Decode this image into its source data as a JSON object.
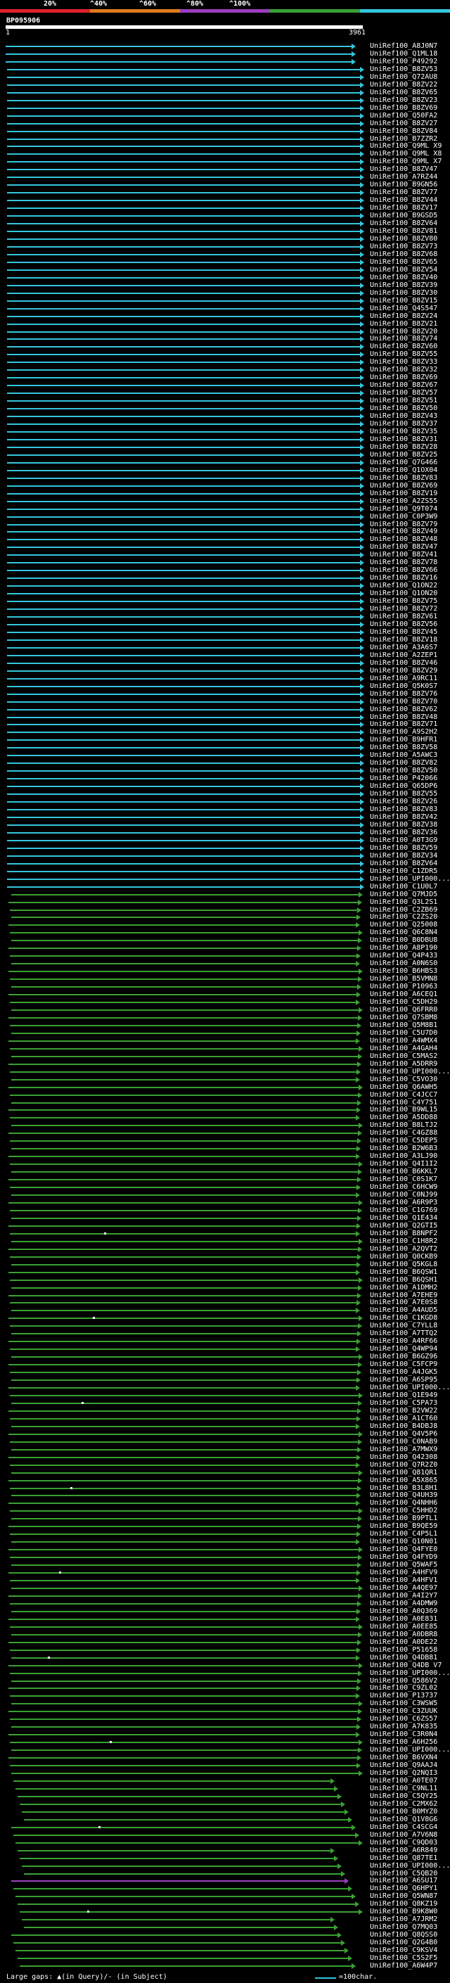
{
  "legend": {
    "labels": [
      "20%",
      "^40%",
      "^60%",
      "^80%",
      "^100%"
    ],
    "colors": [
      "#e0232d",
      "#e07b1f",
      "#9b3fbf",
      "#3aa033",
      "#35c5dd"
    ]
  },
  "title": "BP095906",
  "query": {
    "start": "1",
    "end": "3961"
  },
  "colors": {
    "cyan": "#35c5dd",
    "green": "#3aa033",
    "magenta": "#9b3fbf"
  },
  "hits": [
    "UniRef100_A8J0N7",
    "UniRef100_Q1ML18",
    "UniRef100_P49292",
    "UniRef100_B8ZV53",
    "UniRef100_Q72AU8",
    "UniRef100_B8ZV22",
    "UniRef100_B8ZV65",
    "UniRef100_B8ZV23",
    "UniRef100_B8ZV69",
    "UniRef100_Q50FA2",
    "UniRef100_B8ZV27",
    "UniRef100_B8ZV84",
    "UniRef100_B7ZZR2",
    "UniRef100_Q9ML X9",
    "UniRef100_Q9ML X8",
    "UniRef100_Q9ML X7",
    "UniRef100_B8ZV47",
    "UniRef100_A7RZ44",
    "UniRef100_B9GN56",
    "UniRef100_B8ZV77",
    "UniRef100_B8ZV44",
    "UniRef100_B8ZV17",
    "UniRef100_B9GSD5",
    "UniRef100_B8ZV64",
    "UniRef100_B8ZV81",
    "UniRef100_B8ZV80",
    "UniRef100_B8ZV73",
    "UniRef100_B8ZV68",
    "UniRef100_B8ZV65",
    "UniRef100_B8ZV54",
    "UniRef100_B8ZV40",
    "UniRef100_B8ZV39",
    "UniRef100_B8ZV30",
    "UniRef100_B8ZV15",
    "UniRef100_Q4S547",
    "UniRef100_B8ZV24",
    "UniRef100_B8ZV21",
    "UniRef100_B8ZV20",
    "UniRef100_B8ZV74",
    "UniRef100_B8ZV60",
    "UniRef100_B8ZV55",
    "UniRef100_B8ZV33",
    "UniRef100_B8ZV32",
    "UniRef100_B8ZV69",
    "UniRef100_B8ZV67",
    "UniRef100_B8ZV57",
    "UniRef100_B8ZV51",
    "UniRef100_B8ZV50",
    "UniRef100_B8ZV43",
    "UniRef100_B8ZV37",
    "UniRef100_B8ZV35",
    "UniRef100_B8ZV31",
    "UniRef100_B8ZV28",
    "UniRef100_B8ZV25",
    "UniRef100_Q7G466",
    "UniRef100_Q1OX04",
    "UniRef100_B8ZV83",
    "UniRef100_B8ZV69",
    "UniRef100_B8ZV19",
    "UniRef100_A2ZS55",
    "UniRef100_Q9T074",
    "UniRef100_C0P3W9",
    "UniRef100_B8ZV79",
    "UniRef100_B8ZV49",
    "UniRef100_B8ZV48",
    "UniRef100_B8ZV47",
    "UniRef100_B8ZV41",
    "UniRef100_B8ZV78",
    "UniRef100_B8ZV66",
    "UniRef100_B8ZV16",
    "UniRef100_Q1ON22",
    "UniRef100_Q1ON20",
    "UniRef100_B8ZV75",
    "UniRef100_B8ZV72",
    "UniRef100_B8ZV61",
    "UniRef100_B8ZV56",
    "UniRef100_B8ZV45",
    "UniRef100_B8ZV18",
    "UniRef100_A3A6S7",
    "UniRef100_A2ZEP1",
    "UniRef100_B8ZV46",
    "UniRef100_B8ZV29",
    "UniRef100_A9RC11",
    "UniRef100_Q5K0S7",
    "UniRef100_B8ZV76",
    "UniRef100_B8ZV70",
    "UniRef100_B8ZV62",
    "UniRef100_B8ZV48",
    "UniRef100_B8ZV71",
    "UniRef100_A9S2H2",
    "UniRef100_B9HFR1",
    "UniRef100_B8ZV58",
    "UniRef100_A5AWC3",
    "UniRef100_B8ZV82",
    "UniRef100_B8ZV50",
    "UniRef100_P42066",
    "UniRef100_Q65DP6",
    "UniRef100_B8ZV55",
    "UniRef100_B8ZV26",
    "UniRef100_B8ZV83",
    "UniRef100_B8ZV42",
    "UniRef100_B8ZV38",
    "UniRef100_B8ZV36",
    "UniRef100_A0T3G9",
    "UniRef100_B8ZV59",
    "UniRef100_B8ZV34",
    "UniRef100_B8ZV64",
    "UniRef100_C1ZDR5",
    "UniRef100_UPI000...",
    "UniRef100_C1U0L7",
    "UniRef100_Q7MJD5",
    "UniRef100_Q3L2S1",
    "UniRef100_C2ZB69",
    "UniRef100_C2ZS20",
    "UniRef100_Q25008",
    "UniRef100_Q6C8N4",
    "UniRef100_B0DBU8",
    "UniRef100_A8P190",
    "UniRef100_Q4P433",
    "UniRef100_A0N6S0",
    "UniRef100_B6HBS3",
    "UniRef100_B5VMN8",
    "UniRef100_P10963",
    "UniRef100_A6CEQ1",
    "UniRef100_C5DH29",
    "UniRef100_Q6FRR0",
    "UniRef100_Q7SBM8",
    "UniRef100_Q5M8B1",
    "UniRef100_C5U7D0",
    "UniRef100_A4WMX4",
    "UniRef100_A4GAH4",
    "UniRef100_C5MAS2",
    "UniRef100_A5DRR9",
    "UniRef100_UPI000...",
    "UniRef100_C5VO30",
    "UniRef100_Q6AWH5",
    "UniRef100_C4JCC7",
    "UniRef100_C4Y751",
    "UniRef100_B9WL15",
    "UniRef100_A5DD88",
    "UniRef100_B8LTJ2",
    "UniRef100_C4GZ88",
    "UniRef100_C5DEP5",
    "UniRef100_B2W6B3",
    "UniRef100_A3LJ90",
    "UniRef100_Q4I1I2",
    "UniRef100_B6KKL7",
    "UniRef100_C0S1K7",
    "UniRef100_C6HCW9",
    "UniRef100_C0NJ99",
    "UniRef100_A6R9P3",
    "UniRef100_C1G769",
    "UniRef100_Q1E434",
    "UniRef100_Q2GTI5",
    "UniRef100_B8NPF2",
    "UniRef100_C1H8R2",
    "UniRef100_A2QVT2",
    "UniRef100_Q0CKB9",
    "UniRef100_Q5KGL8",
    "UniRef100_B6QSW1",
    "UniRef100_B6QSH1",
    "UniRef100_A1DMH2",
    "UniRef100_A7EHE9",
    "UniRef100_A7E0S8",
    "UniRef100_A4AUD5",
    "UniRef100_C1KGD8",
    "UniRef100_C7YLL8",
    "UniRef100_A7TTQ2",
    "UniRef100_A4RF66",
    "UniRef100_Q4WP94",
    "UniRef100_B6GZ96",
    "UniRef100_C5FCP9",
    "UniRef100_A4JGK5",
    "UniRef100_A6SP95",
    "UniRef100_UPI000...",
    "UniRef100_Q1E949",
    "UniRef100_C5PA73",
    "UniRef100_B2VW22",
    "UniRef100_A1CT60",
    "UniRef100_B4DBJ8",
    "UniRef100_Q4V5P6",
    "UniRef100_C0NAB9",
    "UniRef100_A7MWX9",
    "UniRef100_Q42308",
    "UniRef100_Q7R2Z0",
    "UniRef100_Q81QR1",
    "UniRef100_A5X865",
    "UniRef100_B3L8H1",
    "UniRef100_Q4UH39",
    "UniRef100_Q4NHH6",
    "UniRef100_C5HHD2",
    "UniRef100_B9PTL1",
    "UniRef100_B9QE59",
    "UniRef100_C4P5L1",
    "UniRef100_Q10N01",
    "UniRef100_Q4FYE0",
    "UniRef100_Q4FYD9",
    "UniRef100_Q5WAF5",
    "UniRef100_A4HFV9",
    "UniRef100_A4HFV1",
    "UniRef100_A4QE97",
    "UniRef100_A4I2Y7",
    "UniRef100_A4DMW9",
    "UniRef100_A0Q369",
    "UniRef100_A0E831",
    "UniRef100_A0EE85",
    "UniRef100_A0DBR8",
    "UniRef100_A0DE22",
    "UniRef100_P51658",
    "UniRef100_Q4DB81",
    "UniRef100_Q4DB V7",
    "UniRef100_UPI000...",
    "UniRef100_Q586V2",
    "UniRef100_C9ZL02",
    "UniRef100_P13737",
    "UniRef100_C3WSW5",
    "UniRef100_C3ZUUK",
    "UniRef100_C6ZS57",
    "UniRef100_A7K835",
    "UniRef100_C3R0N4",
    "UniRef100_A6H256",
    "UniRef100_UPI000...",
    "UniRef100_B6VXN4",
    "UniRef100_Q9AAJ4",
    "UniRef100_Q2NQI3",
    "UniRef100_A0TE07",
    "UniRef100_C9NL11",
    "UniRef100_C5QY25",
    "UniRef100_C2MX62",
    "UniRef100_B0MYZ0",
    "UniRef100_Q1V8G6",
    "UniRef100_C4SCG4",
    "UniRef100_A7V6N8",
    "UniRef100_C9QD03",
    "UniRef100_A6R849",
    "UniRef100_Q87TE1",
    "UniRef100_UPI000...",
    "UniRef100_C5QB20",
    "UniRef100_A6SU17",
    "UniRef100_Q6HPY1",
    "UniRef100_Q5WN87",
    "UniRef100_Q8KZ19",
    "UniRef100_B9K8W0",
    "UniRef100_A7JRM2",
    "UniRef100_Q7MQ03",
    "UniRef100_Q8QSS0",
    "UniRef100_Q2G4B0",
    "UniRef100_C9KSV4",
    "UniRef100_C5S2F5",
    "UniRef100_A6W4P7"
  ],
  "footer": {
    "text": "Large gaps: ▲(in Query)/- (in Subject)",
    "scale_label": "=100char."
  }
}
